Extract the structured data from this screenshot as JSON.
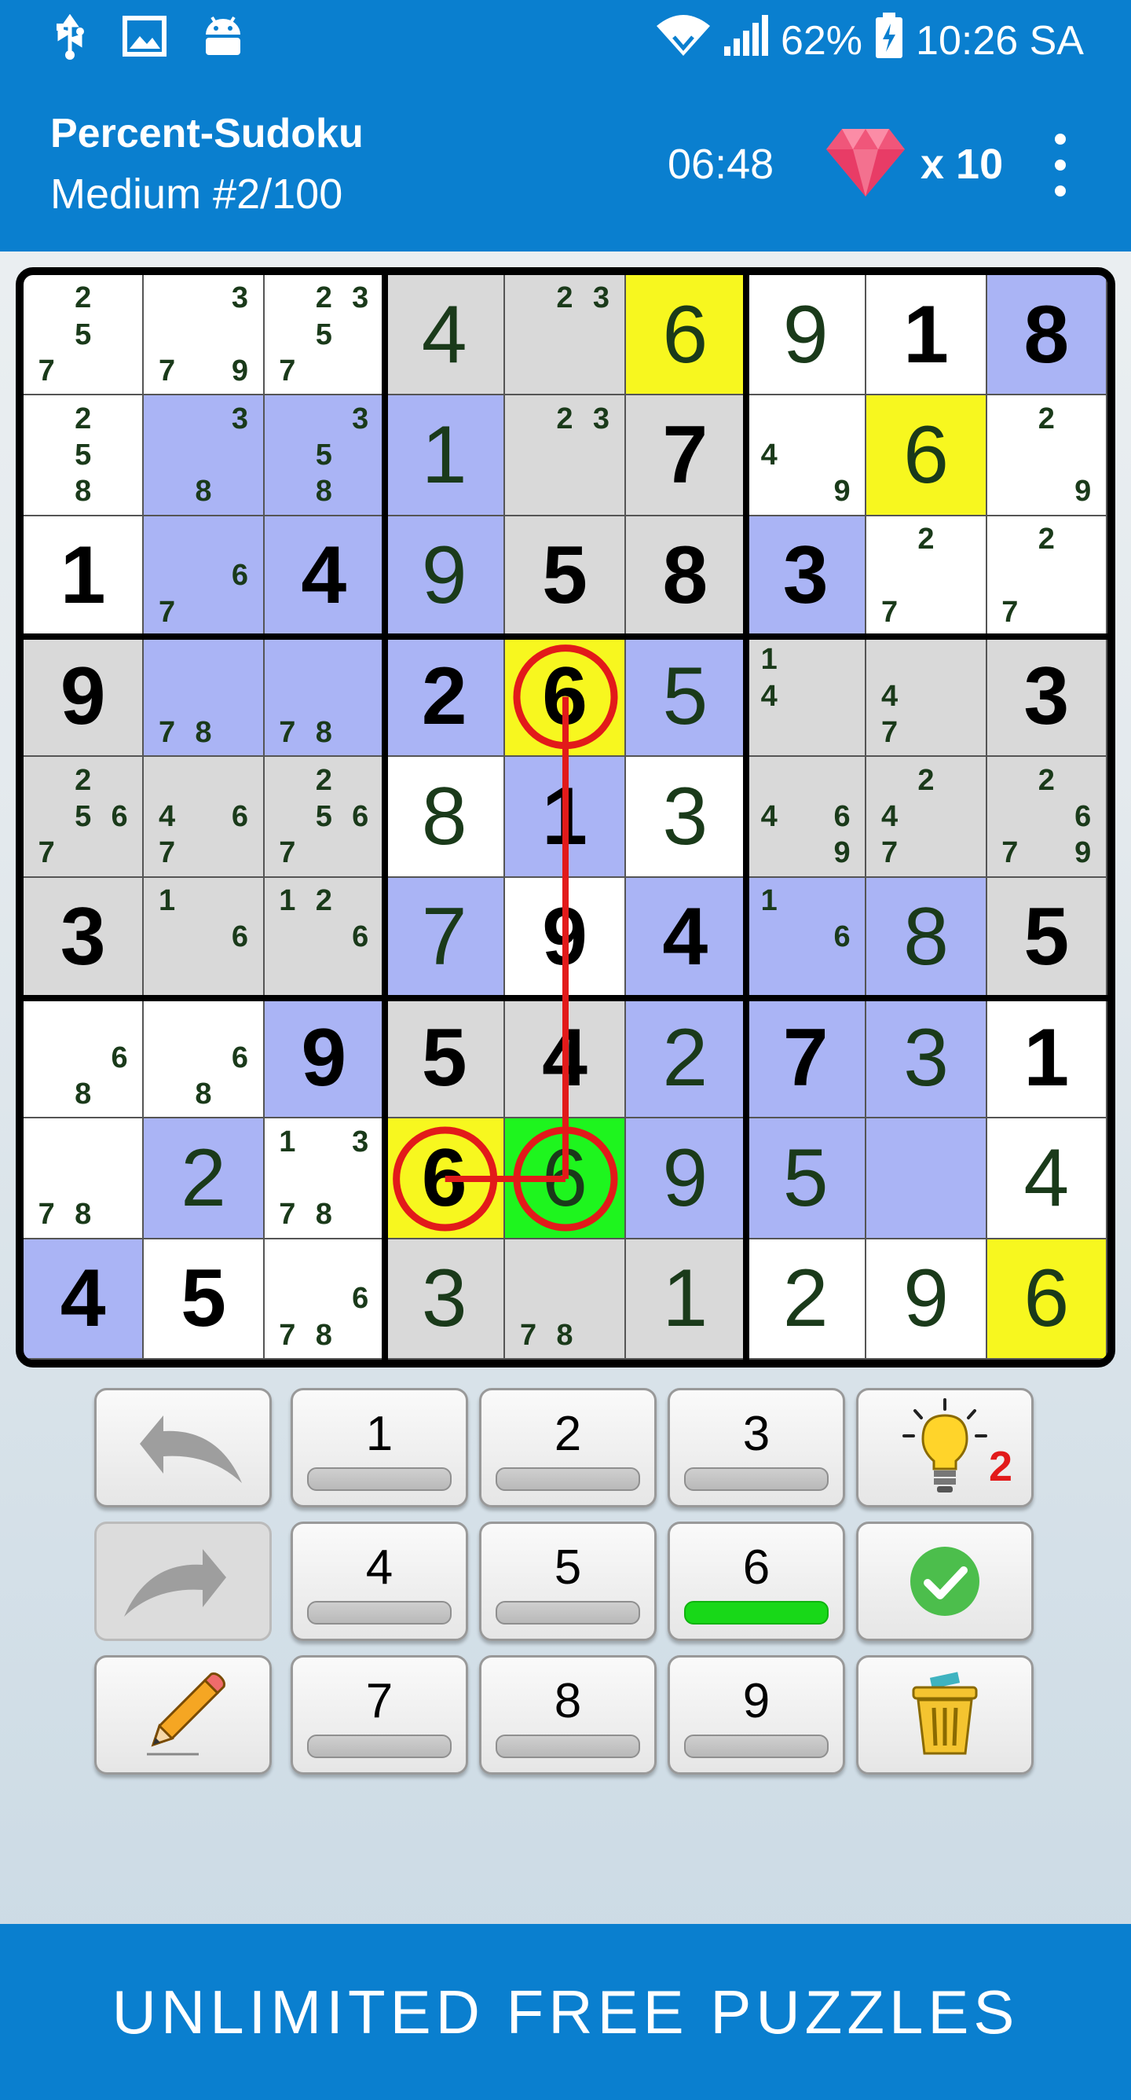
{
  "status_bar": {
    "battery": "62%",
    "time": "10:26 SA",
    "icons": [
      "usb-icon",
      "image-icon",
      "android-icon",
      "wifi-icon",
      "signal-icon",
      "battery-icon"
    ]
  },
  "header": {
    "title": "Percent-Sudoku",
    "subtitle": "Medium  #2/100",
    "timer": "06:48",
    "gems": "x 10"
  },
  "colors": {
    "white": "#ffffff",
    "gray": "#d9d9d9",
    "blue": "#aab4f5",
    "yellow": "#f7f71f",
    "green": "#1ef51e",
    "conflict": "#e21a1a",
    "bar": "#0a7fcf"
  },
  "board": {
    "rows": [
      [
        {
          "n": [
            2,
            5,
            7
          ],
          "bg": "white"
        },
        {
          "n": [
            3,
            7,
            9
          ],
          "bg": "white"
        },
        {
          "n": [
            2,
            3,
            5,
            7
          ],
          "bg": "white"
        },
        {
          "v": "4",
          "t": "entered",
          "bg": "gray"
        },
        {
          "n": [
            2,
            3
          ],
          "bg": "gray"
        },
        {
          "v": "6",
          "t": "entered",
          "bg": "yellow"
        },
        {
          "v": "9",
          "t": "entered",
          "bg": "white"
        },
        {
          "v": "1",
          "t": "given",
          "bg": "white"
        },
        {
          "v": "8",
          "t": "given",
          "bg": "blue"
        }
      ],
      [
        {
          "n": [
            2,
            5,
            8
          ],
          "bg": "white"
        },
        {
          "n": [
            3,
            8
          ],
          "bg": "blue"
        },
        {
          "n": [
            3,
            5,
            8
          ],
          "bg": "blue"
        },
        {
          "v": "1",
          "t": "entered",
          "bg": "blue"
        },
        {
          "n": [
            2,
            3
          ],
          "bg": "gray"
        },
        {
          "v": "7",
          "t": "given",
          "bg": "gray"
        },
        {
          "n": [
            4,
            9
          ],
          "bg": "white"
        },
        {
          "v": "6",
          "t": "entered",
          "bg": "yellow"
        },
        {
          "n": [
            2,
            9
          ],
          "bg": "white"
        }
      ],
      [
        {
          "v": "1",
          "t": "given",
          "bg": "white"
        },
        {
          "n": [
            6,
            7
          ],
          "bg": "blue"
        },
        {
          "v": "4",
          "t": "given",
          "bg": "blue"
        },
        {
          "v": "9",
          "t": "entered",
          "bg": "blue"
        },
        {
          "v": "5",
          "t": "given",
          "bg": "gray"
        },
        {
          "v": "8",
          "t": "given",
          "bg": "gray"
        },
        {
          "v": "3",
          "t": "given",
          "bg": "blue"
        },
        {
          "n": [
            2,
            7
          ],
          "bg": "white"
        },
        {
          "n": [
            2,
            7
          ],
          "bg": "white"
        }
      ],
      [
        {
          "v": "9",
          "t": "given",
          "bg": "gray"
        },
        {
          "n": [
            7,
            8
          ],
          "bg": "blue"
        },
        {
          "n": [
            7,
            8
          ],
          "bg": "blue"
        },
        {
          "v": "2",
          "t": "given",
          "bg": "blue"
        },
        {
          "v": "6",
          "t": "given",
          "bg": "yellow"
        },
        {
          "v": "5",
          "t": "entered",
          "bg": "blue"
        },
        {
          "n": [
            1,
            4
          ],
          "bg": "gray"
        },
        {
          "n": [
            4,
            7
          ],
          "bg": "gray"
        },
        {
          "v": "3",
          "t": "given",
          "bg": "gray"
        }
      ],
      [
        {
          "n": [
            2,
            5,
            6,
            7
          ],
          "bg": "gray"
        },
        {
          "n": [
            4,
            6,
            7
          ],
          "bg": "gray"
        },
        {
          "n": [
            2,
            5,
            6,
            7
          ],
          "bg": "gray"
        },
        {
          "v": "8",
          "t": "entered",
          "bg": "white"
        },
        {
          "v": "1",
          "t": "given",
          "bg": "blue"
        },
        {
          "v": "3",
          "t": "entered",
          "bg": "white"
        },
        {
          "n": [
            4,
            6,
            9
          ],
          "bg": "gray"
        },
        {
          "n": [
            2,
            4,
            7
          ],
          "bg": "gray"
        },
        {
          "n": [
            2,
            6,
            7,
            9
          ],
          "bg": "gray"
        }
      ],
      [
        {
          "v": "3",
          "t": "given",
          "bg": "gray"
        },
        {
          "n": [
            1,
            6
          ],
          "bg": "gray"
        },
        {
          "n": [
            1,
            2,
            6
          ],
          "bg": "gray"
        },
        {
          "v": "7",
          "t": "entered",
          "bg": "blue"
        },
        {
          "v": "9",
          "t": "given",
          "bg": "white"
        },
        {
          "v": "4",
          "t": "given",
          "bg": "blue"
        },
        {
          "n": [
            1,
            6
          ],
          "bg": "blue"
        },
        {
          "v": "8",
          "t": "entered",
          "bg": "blue"
        },
        {
          "v": "5",
          "t": "given",
          "bg": "gray"
        }
      ],
      [
        {
          "n": [
            6,
            8
          ],
          "bg": "white"
        },
        {
          "n": [
            6,
            8
          ],
          "bg": "white"
        },
        {
          "v": "9",
          "t": "given",
          "bg": "blue"
        },
        {
          "v": "5",
          "t": "given",
          "bg": "gray"
        },
        {
          "v": "4",
          "t": "given",
          "bg": "gray"
        },
        {
          "v": "2",
          "t": "entered",
          "bg": "blue"
        },
        {
          "v": "7",
          "t": "given",
          "bg": "blue"
        },
        {
          "v": "3",
          "t": "entered",
          "bg": "blue"
        },
        {
          "v": "1",
          "t": "given",
          "bg": "white"
        }
      ],
      [
        {
          "n": [
            7,
            8
          ],
          "bg": "white"
        },
        {
          "v": "2",
          "t": "entered",
          "bg": "blue"
        },
        {
          "n": [
            1,
            3,
            7,
            8
          ],
          "bg": "white"
        },
        {
          "v": "6",
          "t": "given",
          "bg": "yellow"
        },
        {
          "v": "6",
          "t": "entered",
          "bg": "green"
        },
        {
          "v": "9",
          "t": "entered",
          "bg": "blue"
        },
        {
          "v": "5",
          "t": "entered",
          "bg": "blue"
        },
        {
          "bg": "blue"
        },
        {
          "v": "4",
          "t": "entered",
          "bg": "white"
        }
      ],
      [
        {
          "v": "4",
          "t": "given",
          "bg": "blue"
        },
        {
          "v": "5",
          "t": "given",
          "bg": "white"
        },
        {
          "n": [
            6,
            7,
            8
          ],
          "bg": "white"
        },
        {
          "v": "3",
          "t": "entered",
          "bg": "gray"
        },
        {
          "n": [
            7,
            8
          ],
          "bg": "gray"
        },
        {
          "v": "1",
          "t": "entered",
          "bg": "gray"
        },
        {
          "v": "2",
          "t": "entered",
          "bg": "white"
        },
        {
          "v": "9",
          "t": "entered",
          "bg": "white"
        },
        {
          "v": "6",
          "t": "entered",
          "bg": "yellow"
        }
      ]
    ],
    "conflicts": [
      [
        3,
        4
      ],
      [
        7,
        3
      ],
      [
        7,
        4
      ]
    ]
  },
  "keypad": {
    "number_keys": [
      {
        "label": "1",
        "complete": false
      },
      {
        "label": "2",
        "complete": false
      },
      {
        "label": "3",
        "complete": false
      },
      {
        "label": "4",
        "complete": false
      },
      {
        "label": "5",
        "complete": false
      },
      {
        "label": "6",
        "complete": true
      },
      {
        "label": "7",
        "complete": false
      },
      {
        "label": "8",
        "complete": false
      },
      {
        "label": "9",
        "complete": false
      }
    ],
    "hint_count": "2"
  },
  "banner": {
    "text": "UNLIMITED FREE PUZZLES"
  }
}
